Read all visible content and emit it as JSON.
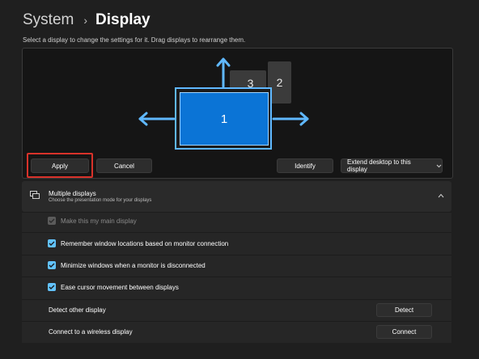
{
  "breadcrumb": {
    "parent": "System",
    "separator": "›",
    "current": "Display"
  },
  "subtitle": "Select a display to change the settings for it. Drag displays to rearrange them.",
  "monitors": [
    {
      "number": "1",
      "selected": true
    },
    {
      "number": "2",
      "selected": false
    },
    {
      "number": "3",
      "selected": false
    }
  ],
  "buttons": {
    "apply": "Apply",
    "cancel": "Cancel",
    "identify": "Identify",
    "extend": "Extend desktop to this display",
    "detect": "Detect",
    "connect": "Connect"
  },
  "multiple_displays": {
    "title": "Multiple displays",
    "description": "Choose the presentation mode for your displays",
    "icon": "multiple-displays-icon",
    "expand_icon": "chevron-up-icon"
  },
  "options": [
    {
      "label": "Make this my main display",
      "checked": true,
      "disabled": true
    },
    {
      "label": "Remember window locations based on monitor connection",
      "checked": true,
      "disabled": false
    },
    {
      "label": "Minimize windows when a monitor is disconnected",
      "checked": true,
      "disabled": false
    },
    {
      "label": "Ease cursor movement between displays",
      "checked": true,
      "disabled": false
    }
  ],
  "detect_label": "Detect other display",
  "connect_label": "Connect to a wireless display",
  "colors": {
    "accent": "#0b74d6",
    "arrow": "#5fb8ff",
    "highlight": "#d8322a",
    "checkbox": "#62c3ff"
  }
}
